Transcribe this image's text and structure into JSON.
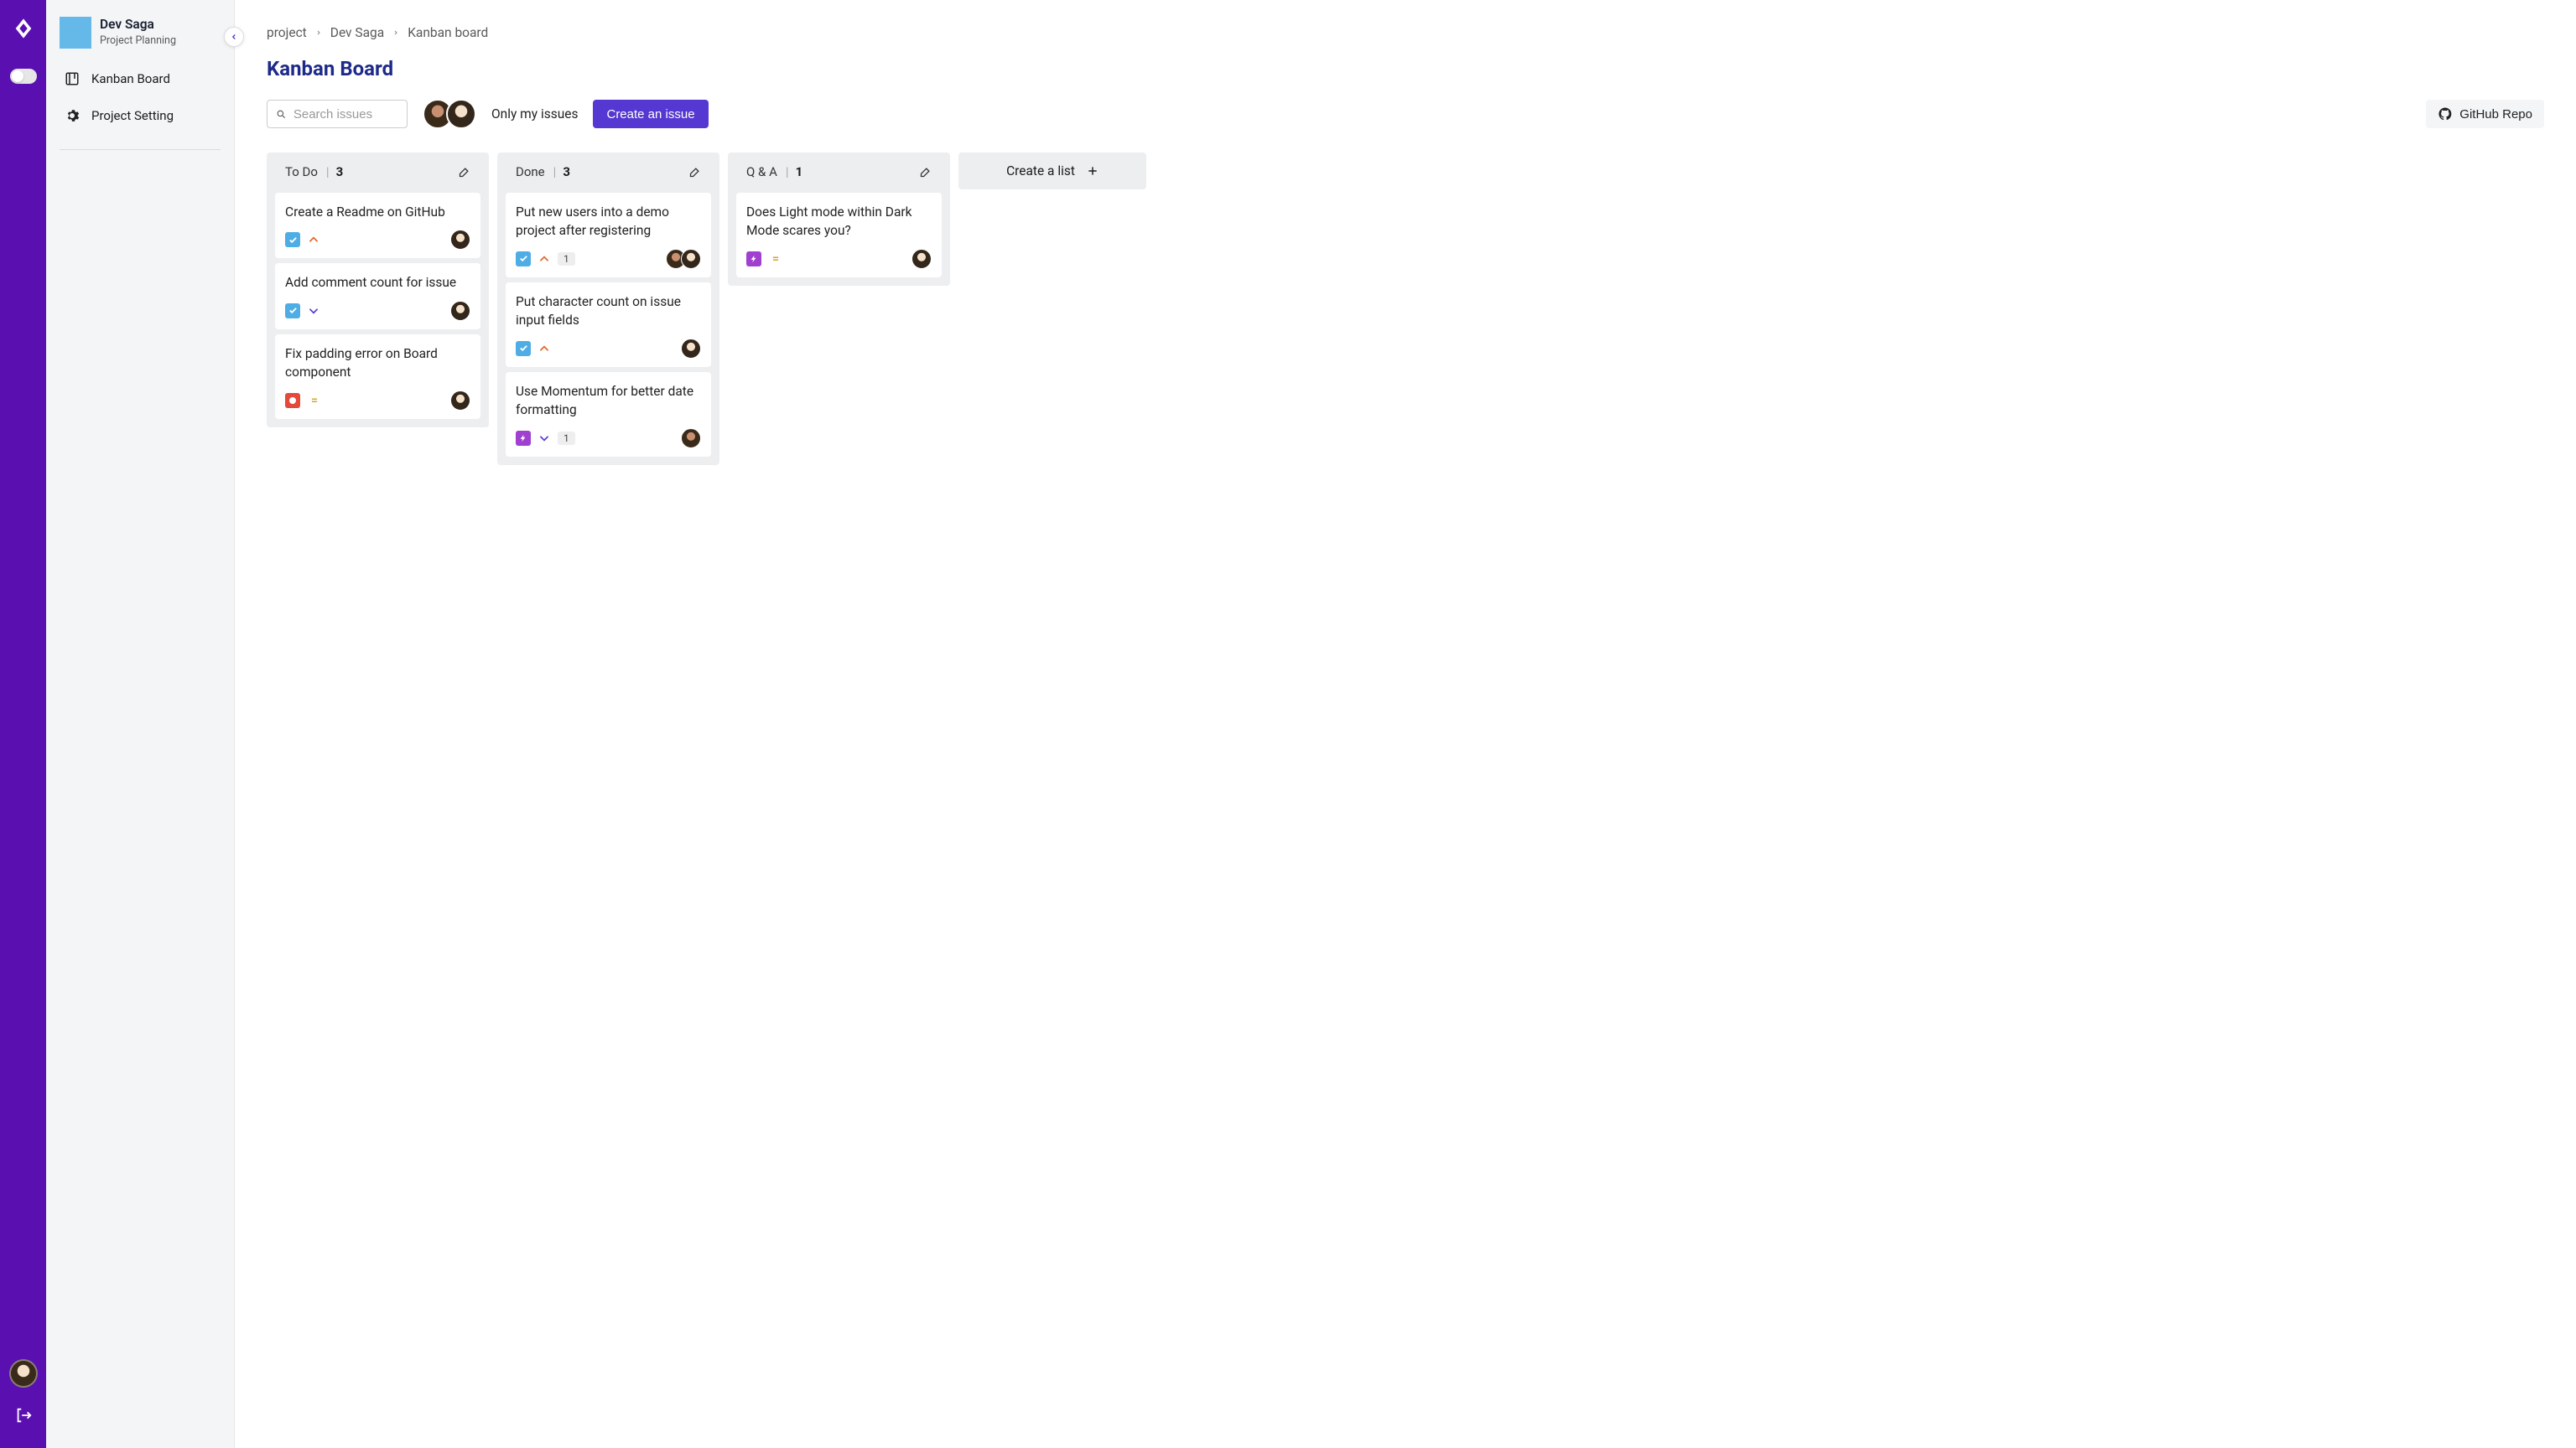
{
  "project": {
    "name": "Dev Saga",
    "subtitle": "Project Planning"
  },
  "sidebar": {
    "items": [
      {
        "label": "Kanban Board"
      },
      {
        "label": "Project Setting"
      }
    ]
  },
  "breadcrumb": [
    "project",
    "Dev Saga",
    "Kanban board"
  ],
  "page_title": "Kanban Board",
  "toolbar": {
    "search_placeholder": "Search issues",
    "only_my": "Only my issues",
    "create_issue": "Create an issue",
    "github": "GitHub Repo"
  },
  "create_list_label": "Create a list",
  "lists": [
    {
      "name": "To Do",
      "count": "3",
      "cards": [
        {
          "title": "Create a Readme on GitHub",
          "type": "task",
          "priority": "high",
          "assignees": [
            "b"
          ]
        },
        {
          "title": "Add comment count for issue",
          "type": "task",
          "priority": "low",
          "assignees": [
            "b"
          ]
        },
        {
          "title": "Fix padding error on Board component",
          "type": "bug",
          "priority": "medium",
          "assignees": [
            "b"
          ]
        }
      ]
    },
    {
      "name": "Done",
      "count": "3",
      "cards": [
        {
          "title": "Put new users into a demo project after registering",
          "type": "task",
          "priority": "high",
          "comments": "1",
          "assignees": [
            "a",
            "b"
          ]
        },
        {
          "title": "Put character count on issue input fields",
          "type": "task",
          "priority": "high",
          "assignees": [
            "b"
          ]
        },
        {
          "title": "Use Momentum for better date formatting",
          "type": "story",
          "priority": "low",
          "comments": "1",
          "assignees": [
            "a"
          ]
        }
      ]
    },
    {
      "name": "Q & A",
      "count": "1",
      "cards": [
        {
          "title": "Does Light mode within Dark Mode scares you?",
          "type": "story",
          "priority": "medium",
          "assignees": [
            "b"
          ]
        }
      ]
    }
  ]
}
